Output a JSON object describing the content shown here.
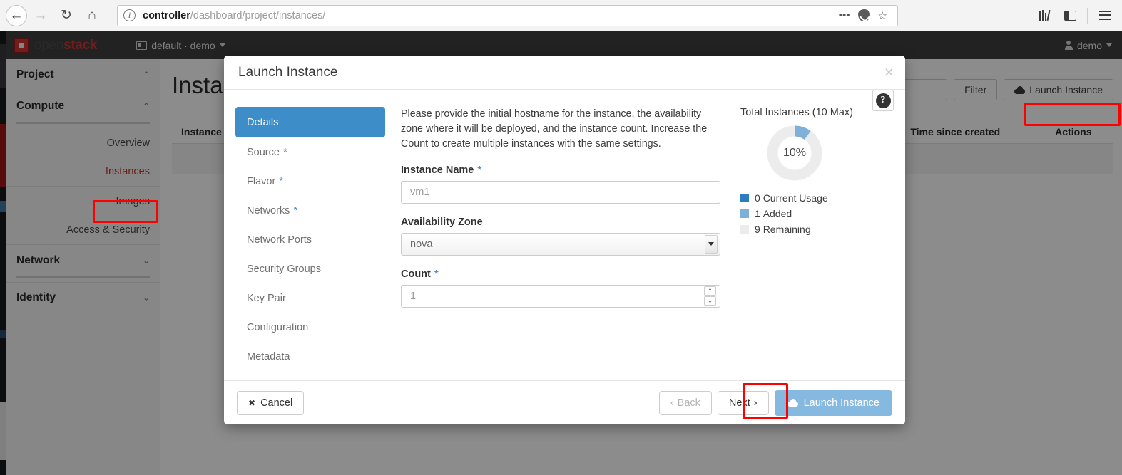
{
  "browser": {
    "back_icon": "back-arrow-icon",
    "forward_icon": "forward-arrow-icon",
    "reload_icon": "↻",
    "home_icon": "⌂",
    "url_host": "controller",
    "url_path": "/dashboard/project/instances/",
    "url_full": "controller/dashboard/project/instances/",
    "info_glyph": "i",
    "ellipsis": "•••",
    "star_glyph": "☆",
    "pocket_icon": "pocket-icon",
    "library_icon": "library-icon",
    "sidebar_icon": "sidebar-icon",
    "menu_icon": "hamburger-menu-icon"
  },
  "os_header": {
    "logo_open": "open",
    "logo_stack": "stack",
    "context": "default · demo",
    "context_caret": "▾",
    "user": "demo",
    "user_caret": "▾"
  },
  "sidebar": {
    "groups": [
      {
        "label": "Project",
        "chevron": "⌃"
      },
      {
        "label": "Compute",
        "chevron": "⌃"
      },
      {
        "label": "Network",
        "chevron": "⌄"
      },
      {
        "label": "Identity",
        "chevron": "⌄"
      }
    ],
    "compute_items": [
      {
        "label": "Overview",
        "active": false
      },
      {
        "label": "Instances",
        "active": true
      },
      {
        "label": "Images",
        "active": false
      },
      {
        "label": "Access & Security",
        "active": false
      }
    ]
  },
  "page": {
    "title": "Instances",
    "search_placeholder": "",
    "filter_label": "Filter",
    "launch_label": "Launch Instance",
    "table_headers": [
      "Instance Name",
      "Time since created",
      "Actions"
    ]
  },
  "modal": {
    "title": "Launch Instance",
    "close_glyph": "×",
    "help_glyph": "?",
    "tabs": [
      {
        "label": "Details",
        "required": false,
        "active": true
      },
      {
        "label": "Source",
        "required": true,
        "active": false
      },
      {
        "label": "Flavor",
        "required": true,
        "active": false
      },
      {
        "label": "Networks",
        "required": true,
        "active": false
      },
      {
        "label": "Network Ports",
        "required": false,
        "active": false
      },
      {
        "label": "Security Groups",
        "required": false,
        "active": false
      },
      {
        "label": "Key Pair",
        "required": false,
        "active": false
      },
      {
        "label": "Configuration",
        "required": false,
        "active": false
      },
      {
        "label": "Metadata",
        "required": false,
        "active": false
      }
    ],
    "required_marker": "*",
    "intro": "Please provide the initial hostname for the instance, the availability zone where it will be deployed, and the instance count. Increase the Count to create multiple instances with the same settings.",
    "fields": {
      "instance_name_label": "Instance Name",
      "instance_name_value": "vm1",
      "availability_zone_label": "Availability Zone",
      "availability_zone_value": "nova",
      "count_label": "Count",
      "count_value": "1",
      "spin_up": "⌃",
      "spin_down": "⌄"
    },
    "footer": {
      "cancel_label": "Cancel",
      "cancel_glyph": "✖",
      "back_label": "Back",
      "back_glyph": "‹",
      "next_label": "Next",
      "next_glyph": "›",
      "launch_label": "Launch Instance"
    }
  },
  "chart_data": {
    "type": "pie",
    "title": "Total Instances (10 Max)",
    "center_label": "10%",
    "max": 10,
    "categories": [
      "Current Usage",
      "Added",
      "Remaining"
    ],
    "values": [
      0,
      1,
      9
    ],
    "colors": [
      "#2b7cc0",
      "#7eb0d8",
      "#ececec"
    ],
    "legend": [
      {
        "value": "0",
        "label": "Current Usage",
        "color": "#2b7cc0"
      },
      {
        "value": "1",
        "label": "Added",
        "color": "#7eb0d8"
      },
      {
        "value": "9",
        "label": "Remaining",
        "color": "#ececec"
      }
    ],
    "legend_position": "below",
    "donut": true
  },
  "theme": {
    "accent_blue": "#3c8dc8",
    "light_blue": "#85b9df",
    "annotation_red": "#ff0000"
  }
}
